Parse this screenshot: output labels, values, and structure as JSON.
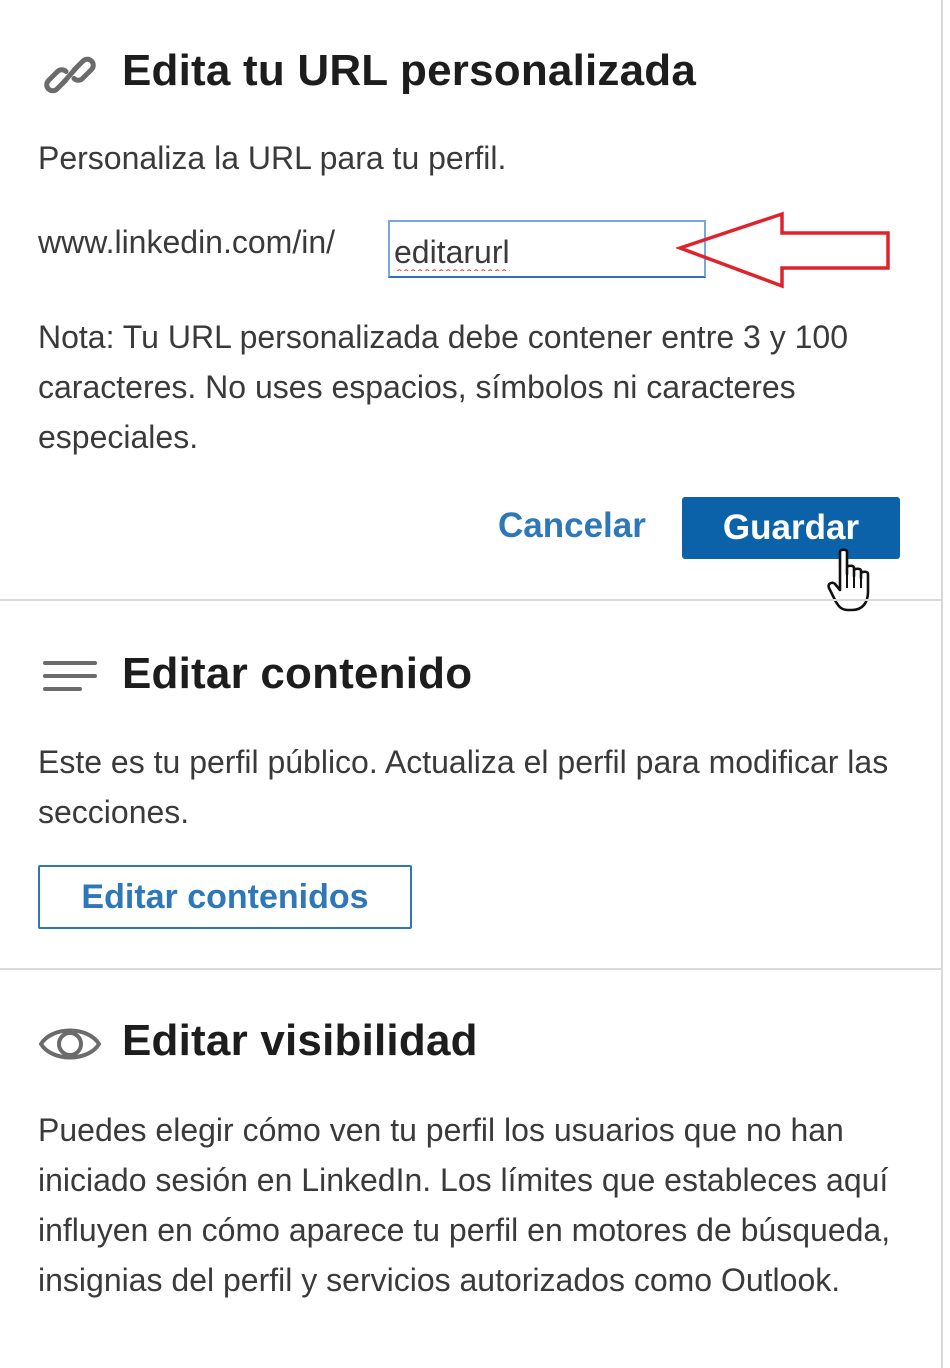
{
  "url_section": {
    "title": "Edita tu URL personalizada",
    "icon": "link-icon",
    "description": "Personaliza la URL para tu perfil.",
    "url_prefix": "www.linkedin.com/in/",
    "url_value": "editarurl",
    "note": "Nota: Tu URL personalizada debe contener entre 3 y 100 caracteres. No uses espacios, símbolos ni caracteres especiales.",
    "cancel_label": "Cancelar",
    "save_label": "Guardar"
  },
  "content_section": {
    "title": "Editar contenido",
    "icon": "lines-icon",
    "description": "Este es tu perfil público. Actualiza el perfil para modificar las secciones.",
    "button_label": "Editar contenidos"
  },
  "visibility_section": {
    "title": "Editar visibilidad",
    "icon": "eye-icon",
    "description": "Puedes elegir cómo ven tu perfil los usuarios que no han iniciado sesión en LinkedIn. Los límites que estableces aquí influyen en cómo aparece tu perfil en motores de búsqueda, insignias del perfil y servicios autorizados como Outlook."
  },
  "colors": {
    "primary_button": "#0b62a8",
    "link": "#2e77b8",
    "annotation_arrow": "#e0232b"
  }
}
